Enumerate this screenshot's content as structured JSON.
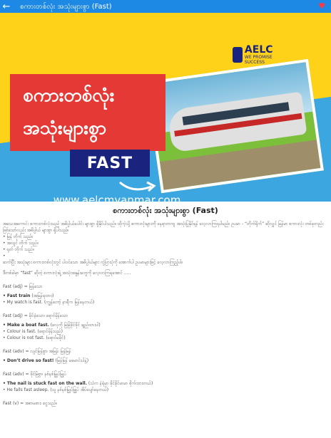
{
  "appbar": {
    "back_label": "←",
    "title": "စကားတစ်လုံး အသုံးများစွာ (Fast)",
    "heart_label": "♥"
  },
  "banner": {
    "title_line1": "စကားတစ်လုံး",
    "title_line2": "အသုံးများစွာ",
    "fast": "FAST",
    "url": "www.aelcmyanmar.com",
    "logo_name": "AELC",
    "logo_tag": "WE PROMISE SUCCESS"
  },
  "article": {
    "heading": "စကားတစ်လုံး အသုံးများစွာ (Fast)",
    "intro": "အသေအကောင်း စကားတစ်လုံးသည် အဓိပ္ပါယ်ပေါင်း များစွာ ရှိနိုင်ပါသည်။ ထိုကဲ့သို့ စကားလုံးများကို နေရာတကျ အသုံးပြုနိုင်ရန် လေ့လာကြရပါမည်။ ဥပမာ - “တိုက်ရိုက်” ဆိုလျှင် မြန်မာ စကားလုံး တစ်ခုတည်း ဖြစ်သော်လည်း အဓိပ္ပါယ် များစွာ ရှိပါသည်။",
    "bullets": [
      "• မြန် တိုက် သည်။",
      "• အလျင် တိုက် သည်။",
      "• ရုတ် တိုက် သည်။",
      "•"
    ],
    "intro2": "ဆက်ပြီး အသုံးများ စကားတစ်လုံးတွင် ပါဝင်သော အဓိပ္ပါယ်များ ကွဲပြားပုံကို အောက်ပါ ဥပမာများဖြင့် လေ့လာကြည့်ပါ။",
    "lead": "ဒီတစ်ခါမှာ “fast” ဆိုတဲ့ စကားလုံးရဲ့ အသုံးအနှုန်းတွေကို လေ့လာကြရအောင် .....",
    "entries": [
      {
        "head": "Fast (adj) = မြန်သော",
        "ex": [
          {
            "en": "• Fast train",
            "mm": " (အမြန်ရထား)"
          },
          {
            "en": "• My watch is fast.",
            "mm": " (ကျွန်တော့် နာရီက မြန်နေတယ်)"
          }
        ]
      },
      {
        "head": "Fast (adj) = ခိုင်ခံ့သော၊ ရောင်မှိန်သော",
        "ex": [
          {
            "en": "• Make a boat fast.",
            "mm": " (လှေကို မြဲမြံခိုင်ခိုင် ချည်ထားပါ)"
          },
          {
            "en": "• Colour is fast.",
            "mm": " (ရောင်မှိန်သည်)"
          },
          {
            "en": "• Colour is not fast.",
            "mm": " (ရောင်မခိုင်)"
          }
        ]
      },
      {
        "head": "Fast (adv) = လျင်မြန်စွာ၊ အမြန်၊ မြန်မြန်",
        "ex": [
          {
            "en": "• Don’t drive so fast!",
            "mm": " (မြန်မြန် မမောင်းပါနဲ့)"
          }
        ]
      },
      {
        "head": "Fast (adv) = ခိုင်မြဲစွာ၊ နစ်နစ်မြှုပ်မြှုပ်",
        "ex": [
          {
            "en": "• The nail is stuck fast on the wall.",
            "mm": " (သံက နံရံမှာ ခိုင်ခိုင်မာမာ စိုက်ထားတယ်)"
          },
          {
            "en": "• He falls fast asleep.",
            "mm": " (သူ နစ်နစ်မြှုပ်မြှုပ် အိပ်ပျော်နေတယ်)"
          }
        ]
      },
      {
        "head": "Fast (v) = အစာမစား၊ ငွေသည်။",
        "ex": []
      }
    ]
  }
}
